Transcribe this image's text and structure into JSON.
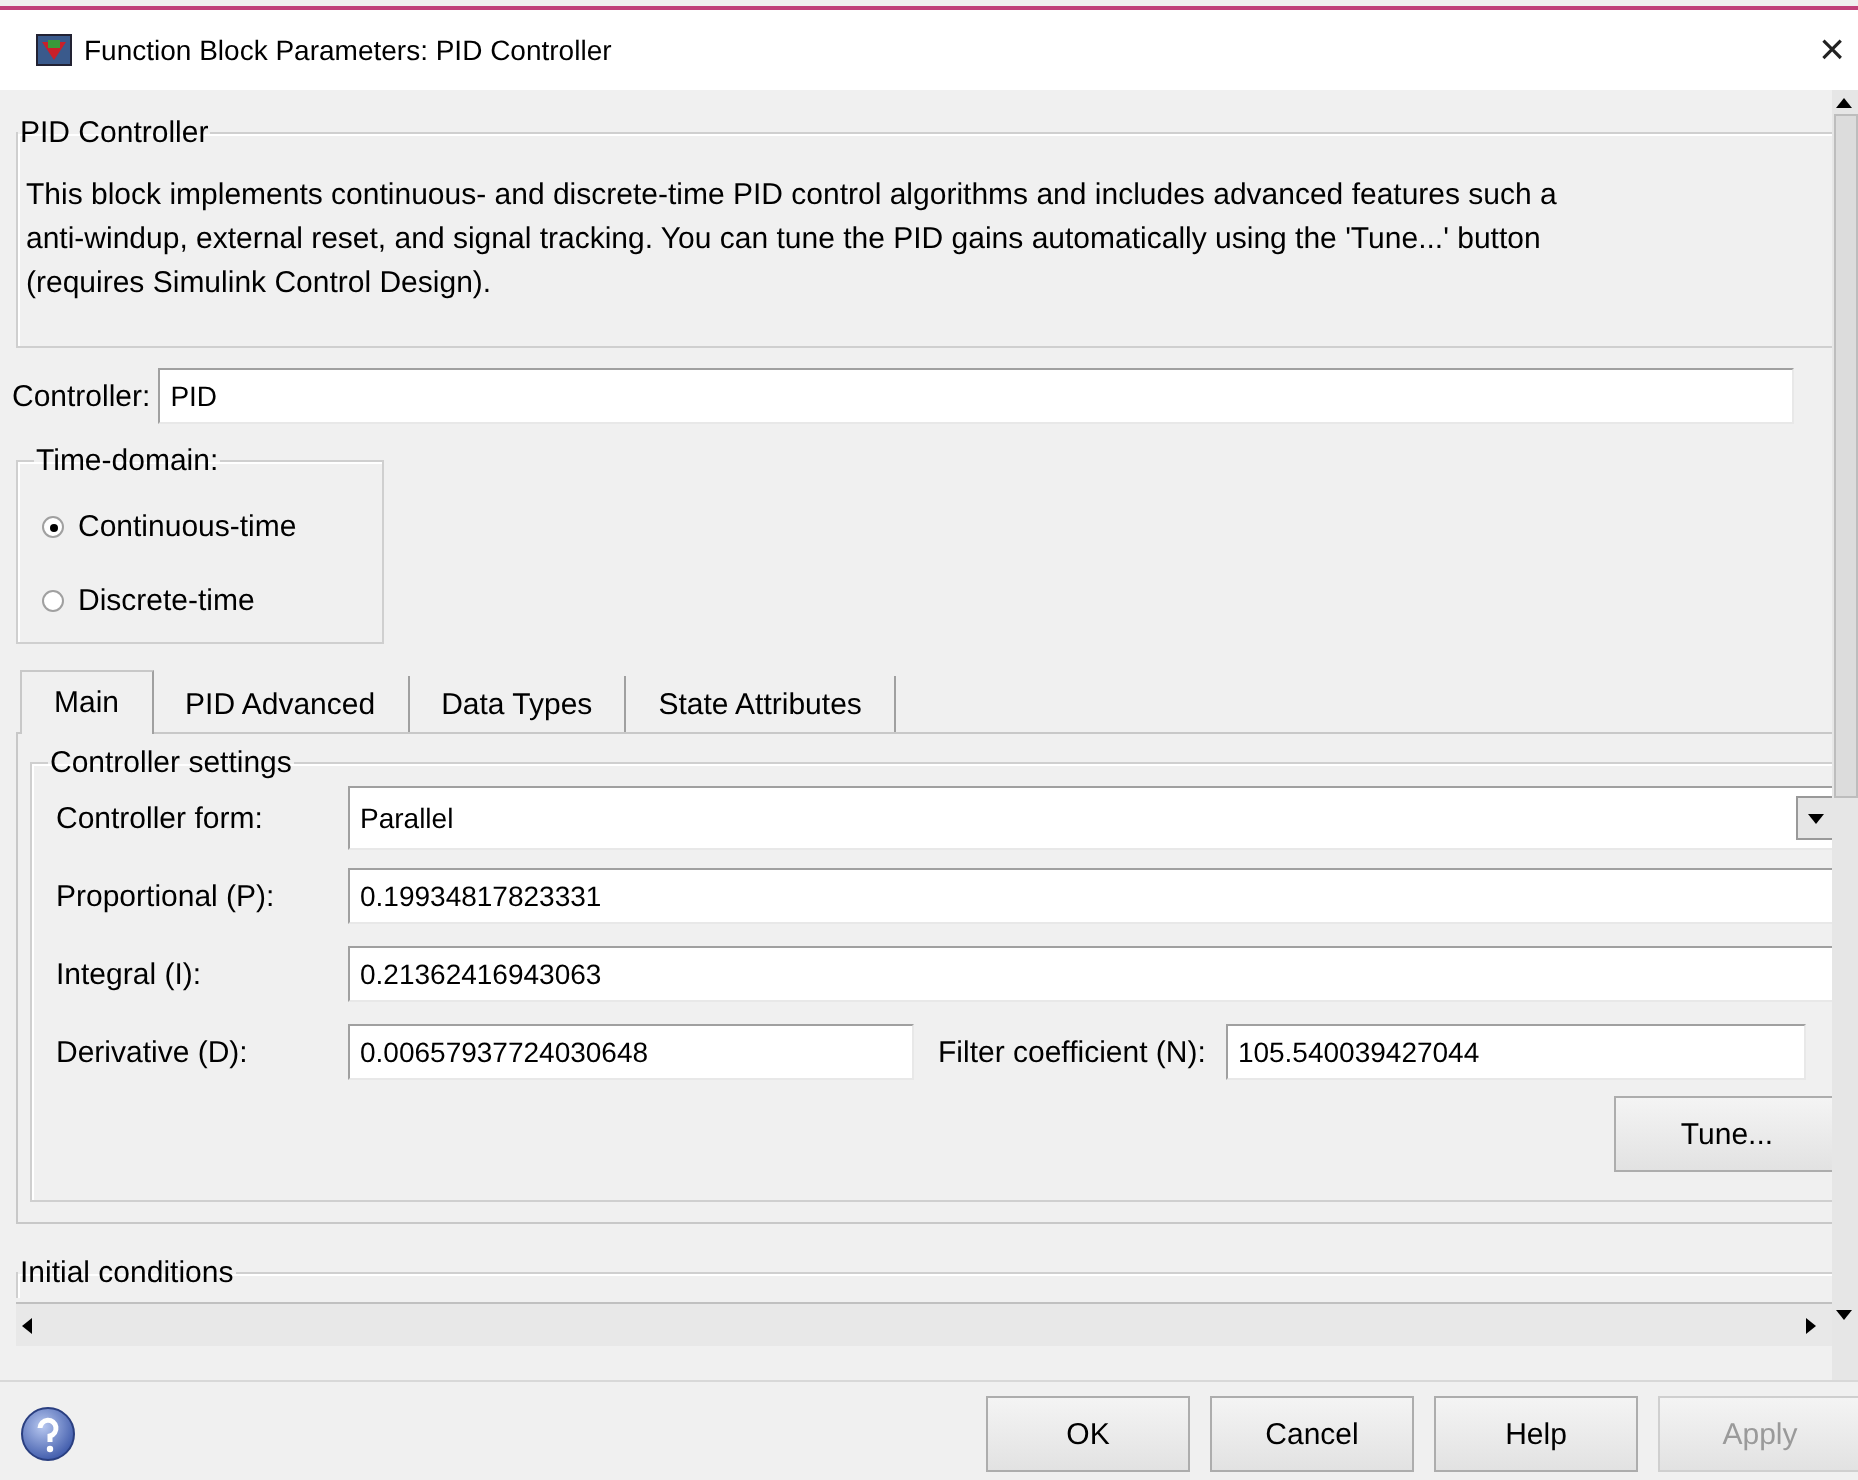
{
  "window": {
    "title": "Function Block Parameters: PID Controller",
    "close": "×"
  },
  "description_group": {
    "title": "PID Controller",
    "text": "This block implements continuous- and discrete-time PID control algorithms and includes advanced features such a\nanti-windup, external reset, and signal tracking. You can tune the PID gains automatically using the 'Tune...' button\n(requires Simulink Control Design)."
  },
  "controller": {
    "label": "Controller:",
    "value": "PID"
  },
  "time_domain": {
    "title": "Time-domain:",
    "options": [
      {
        "label": "Continuous-time",
        "selected": true
      },
      {
        "label": "Discrete-time",
        "selected": false
      }
    ]
  },
  "tabs": [
    {
      "label": "Main",
      "selected": true
    },
    {
      "label": "PID Advanced",
      "selected": false
    },
    {
      "label": "Data Types",
      "selected": false
    },
    {
      "label": "State Attributes",
      "selected": false
    }
  ],
  "settings": {
    "title": "Controller settings",
    "rows": [
      {
        "kind": "dropdown",
        "label": "Controller form:",
        "value": "Parallel"
      },
      {
        "kind": "text",
        "label": "Proportional (P):",
        "value": "0.19934817823331"
      },
      {
        "kind": "text",
        "label": "Integral (I):",
        "value": "0.21362416943063"
      },
      {
        "kind": "pair",
        "label": "Derivative (D):",
        "value": "0.00657937724030648",
        "label_2": "Filter coefficient (N):",
        "value_2": "105.540039427044"
      }
    ],
    "tune_button": "Tune..."
  },
  "initial_group": {
    "title": "Initial conditions"
  },
  "buttons": [
    {
      "label": "OK",
      "disabled": false
    },
    {
      "label": "Cancel",
      "disabled": false
    },
    {
      "label": "Help",
      "disabled": false
    },
    {
      "label": "Apply",
      "disabled": true
    }
  ]
}
